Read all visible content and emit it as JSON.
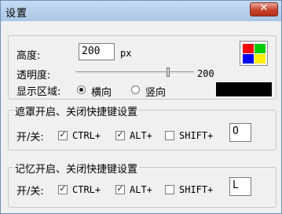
{
  "window": {
    "title": "设置",
    "close_glyph": "✕"
  },
  "display": {
    "height_label": "高度:",
    "height_value": "200",
    "height_unit": "px",
    "opacity_label": "透明度:",
    "opacity_value": "200",
    "opacity_level": 0.78,
    "region_label": "显示区域:",
    "horizontal_label": "横向",
    "vertical_label": "竖向",
    "selected_orientation": "横向",
    "palette_colors": [
      "#ff0000",
      "#00cc00",
      "#0000ff",
      "#ffee00"
    ],
    "preview_color": "#000000"
  },
  "mask_group": {
    "title": "遮罩开启、关闭快捷键设置",
    "toggle_label": "开/关:",
    "ctrl_label": "CTRL+",
    "ctrl_checked": true,
    "alt_label": "ALT+",
    "alt_checked": true,
    "shift_label": "SHIFT+",
    "shift_checked": false,
    "key_value": "O"
  },
  "memory_group": {
    "title": "记忆开启、关闭快捷键设置",
    "toggle_label": "开/关:",
    "ctrl_label": "CTRL+",
    "ctrl_checked": true,
    "alt_label": "ALT+",
    "alt_checked": true,
    "shift_label": "SHIFT+",
    "shift_checked": false,
    "key_value": "L"
  }
}
